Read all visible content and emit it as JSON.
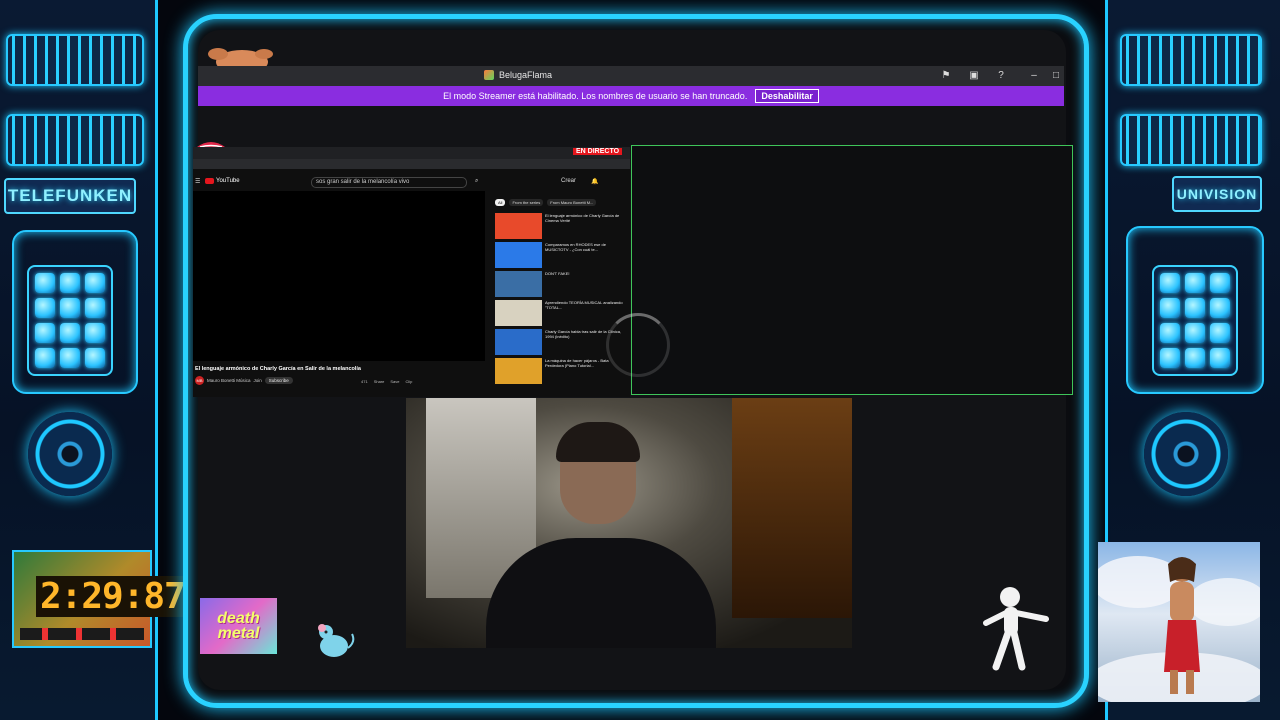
{
  "overlay": {
    "left_label": "TELEFUNKEN",
    "right_label": "UNIVISION",
    "clock": "2:29:87",
    "sticker": "death metal"
  },
  "window": {
    "title": "BelugaFlama",
    "buttons": [
      "flag-icon",
      "inbox-icon",
      "help-icon",
      "minimize-icon",
      "maximize-icon"
    ]
  },
  "streamer_banner": {
    "text": "El modo Streamer está habilitado. Los nombres de usuario se han truncado.",
    "button": "Deshabilitar",
    "color": "#8a2de0"
  },
  "browser": {
    "live_badge": "EN DIRECTO",
    "search_query": "sos gran salir de la melancolía vivo",
    "create_label": "Crear",
    "youtube_logo": "YouTube",
    "video_title": "El lenguaje armónico de Charly García en Salir de la melancolía",
    "channel": "Mauro Bonetti Música",
    "join": "Join",
    "subscribe": "Subscribe",
    "actions": [
      "471",
      "Share",
      "Save",
      "Clip"
    ],
    "chips": [
      "All",
      "From the series",
      "From Mauro Bonetti M..."
    ],
    "recommendations": [
      {
        "title": "El lenguaje armónico de Charly García de Cinema Verité",
        "color": "#e84a2b"
      },
      {
        "title": "Comparamos en RHODES ese de MUSICTOTV - ¿Con cuál te...",
        "color": "#2b7ae8"
      },
      {
        "title": "DON'T FAKE!",
        "color": "#3a6ea5"
      },
      {
        "title": "Aprendiendo TEORÍA MUSICAL analizando \"TOTAL...",
        "color": "#d8d2c0"
      },
      {
        "title": "Charly García habla tras salir de la Clínica, 1994 (inédito)",
        "color": "#2a6cc9"
      },
      {
        "title": "La máquina de hacer pájaros - Bata Perdedora (Piano Tutorial...",
        "color": "#e0a12a"
      }
    ]
  }
}
